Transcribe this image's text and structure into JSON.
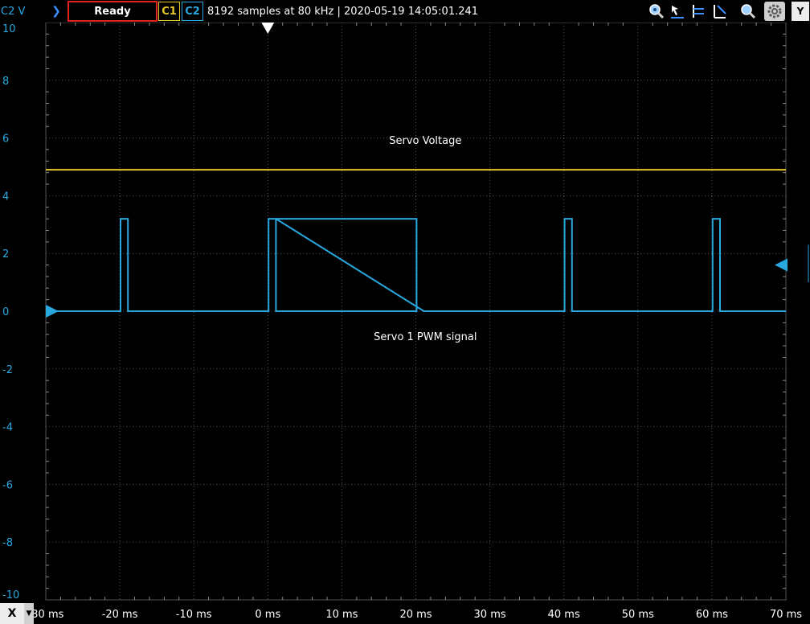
{
  "toolbar": {
    "axis_unit": "C2 V",
    "status": "Ready",
    "c1_label": "C1",
    "c2_label": "C2",
    "info": "8192 samples at 80 kHz | 2020-05-19 14:05:01.241",
    "y_button": "Y",
    "x_button": "X",
    "icons": [
      "zoom-reset-icon",
      "cursor-icon",
      "cursor-horizontal-icon",
      "cursor-vertical-icon",
      "zoom-icon",
      "settings-gear-icon"
    ]
  },
  "colors": {
    "c1": "#e7c62a",
    "c2": "#29a8e0",
    "status_border": "#e32219",
    "grid": "#555555",
    "background": "#000000"
  },
  "chart_data": {
    "type": "line",
    "xlim": [
      -30,
      70
    ],
    "ylim": [
      -10,
      10
    ],
    "x_ticks": [
      "-30 ms",
      "-20 ms",
      "-10 ms",
      "0 ms",
      "10 ms",
      "20 ms",
      "30 ms",
      "40 ms",
      "50 ms",
      "60 ms",
      "70 ms"
    ],
    "x_tick_values": [
      -30,
      -20,
      -10,
      0,
      10,
      20,
      30,
      40,
      50,
      60,
      70
    ],
    "y_ticks": [
      "10",
      "8",
      "6",
      "4",
      "2",
      "0",
      "-2",
      "-4",
      "-6",
      "-8",
      "-10"
    ],
    "y_tick_values": [
      10,
      8,
      6,
      4,
      2,
      0,
      -2,
      -4,
      -6,
      -8,
      -10
    ],
    "grid": true,
    "trigger_time": 0,
    "c2_offset_level": 0,
    "c2_trigger_level": 1.6,
    "annotations": [
      {
        "text": "Servo Voltage",
        "x": 0,
        "y": 5.8
      },
      {
        "text": "Servo 1 PWM signal",
        "x": 0,
        "y": -1
      }
    ],
    "series": [
      {
        "channel": "C1",
        "x": [
          -30,
          70
        ],
        "y": [
          4.9,
          4.9
        ]
      },
      {
        "channel": "C2",
        "x": [
          -30,
          -19.9,
          -19.9,
          -18.9,
          -18.9,
          0.1,
          0.1,
          1.1,
          1.1,
          20.1,
          20.1,
          1.1,
          21.1,
          40.1,
          40.1,
          41.1,
          41.1,
          60.1,
          60.1,
          61.1,
          61.1,
          70
        ],
        "y": [
          0,
          0,
          3.2,
          3.2,
          0,
          0,
          3.2,
          3.2,
          0,
          0,
          3.2,
          3.2,
          0,
          0,
          3.2,
          3.2,
          0,
          0,
          3.2,
          3.2,
          0,
          0
        ]
      }
    ]
  }
}
